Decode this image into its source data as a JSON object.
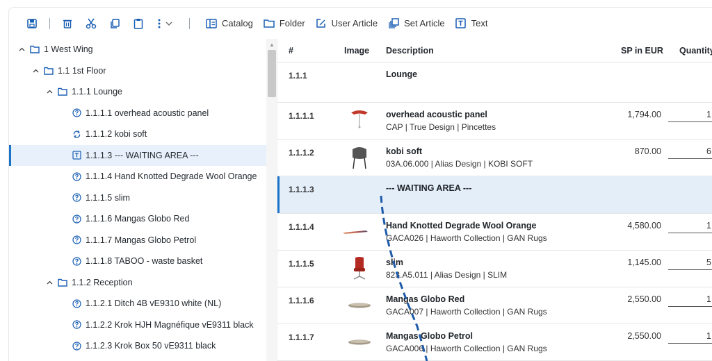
{
  "toolbar": {
    "buttons": [
      {
        "label": "Catalog",
        "icon": "catalog-icon"
      },
      {
        "label": "Folder",
        "icon": "folder-icon"
      },
      {
        "label": "User Article",
        "icon": "edit-icon"
      },
      {
        "label": "Set Article",
        "icon": "set-article-icon"
      },
      {
        "label": "Text",
        "icon": "text-icon"
      }
    ]
  },
  "tree": {
    "items": [
      {
        "label": "1 West Wing",
        "icon": "folder-icon",
        "expanded": true
      },
      {
        "label": "1.1 1st Floor",
        "icon": "folder-icon",
        "expanded": true
      },
      {
        "label": "1.1.1 Lounge",
        "icon": "folder-icon",
        "expanded": true
      },
      {
        "label": "1.1.1.1 overhead acoustic panel",
        "icon": "help-circle-icon"
      },
      {
        "label": "1.1.1.2 kobi soft",
        "icon": "sync-icon"
      },
      {
        "label": "1.1.1.3 --- WAITING AREA ---",
        "icon": "text-icon",
        "selected": true
      },
      {
        "label": "1.1.1.4 Hand Knotted Degrade Wool Orange",
        "icon": "help-circle-icon"
      },
      {
        "label": "1.1.1.5 slim",
        "icon": "help-circle-icon"
      },
      {
        "label": "1.1.1.6 Mangas Globo Red",
        "icon": "help-circle-icon"
      },
      {
        "label": "1.1.1.7 Mangas Globo Petrol",
        "icon": "help-circle-icon"
      },
      {
        "label": "1.1.1.8 TABOO - waste basket",
        "icon": "help-circle-icon"
      },
      {
        "label": "1.1.2 Reception",
        "icon": "folder-icon",
        "expanded": true
      },
      {
        "label": "1.1.2.1 Ditch 4B vE9310 white (NL)",
        "icon": "help-circle-icon"
      },
      {
        "label": "1.1.2.2 Krok HJH Magnéfique vE9311 black",
        "icon": "help-circle-icon"
      },
      {
        "label": "1.1.2.3 Krok Box 50 vE9311 black",
        "icon": "help-circle-icon"
      }
    ]
  },
  "grid": {
    "columns": {
      "num": "#",
      "image": "Image",
      "description": "Description",
      "sp": "SP in EUR",
      "qty": "Quantity"
    },
    "rows": [
      {
        "num": "1.1.1",
        "title": "Lounge",
        "sub": "",
        "sp": "",
        "qty": "",
        "image": "none"
      },
      {
        "num": "1.1.1.1",
        "title": "overhead acoustic panel",
        "sub": "CAP | True Design | Pincettes",
        "sp": "1,794.00",
        "qty": "1",
        "image": "pendant-lamp"
      },
      {
        "num": "1.1.1.2",
        "title": "kobi soft",
        "sub": "03A.06.000 | Alias Design | KOBI SOFT",
        "sp": "870.00",
        "qty": "6",
        "image": "chair"
      },
      {
        "num": "1.1.1.3",
        "title": "--- WAITING AREA ---",
        "sub": "",
        "sp": "",
        "qty": "",
        "image": "none",
        "selected": true
      },
      {
        "num": "1.1.1.4",
        "title": "Hand Knotted Degrade Wool Orange",
        "sub": "GACA026 | Haworth Collection | GAN Rugs",
        "sp": "4,580.00",
        "qty": "1",
        "image": "rug"
      },
      {
        "num": "1.1.1.5",
        "title": "slim",
        "sub": "823.A5.011 | Alias Design | SLIM",
        "sp": "1,145.00",
        "qty": "5",
        "image": "office-chair"
      },
      {
        "num": "1.1.1.6",
        "title": "Mangas Globo Red",
        "sub": "GACA007 | Haworth Collection | GAN Rugs",
        "sp": "2,550.00",
        "qty": "1",
        "image": "pouf"
      },
      {
        "num": "1.1.1.7",
        "title": "Mangas Globo Petrol",
        "sub": "GACA006 | Haworth Collection | GAN Rugs",
        "sp": "2,550.00",
        "qty": "1",
        "image": "pouf"
      }
    ]
  },
  "colors": {
    "accent": "#1a73c9",
    "selected_bg": "#e3eef9",
    "icon": "#1a5fb4",
    "drag_line": "#1e5aa8"
  }
}
